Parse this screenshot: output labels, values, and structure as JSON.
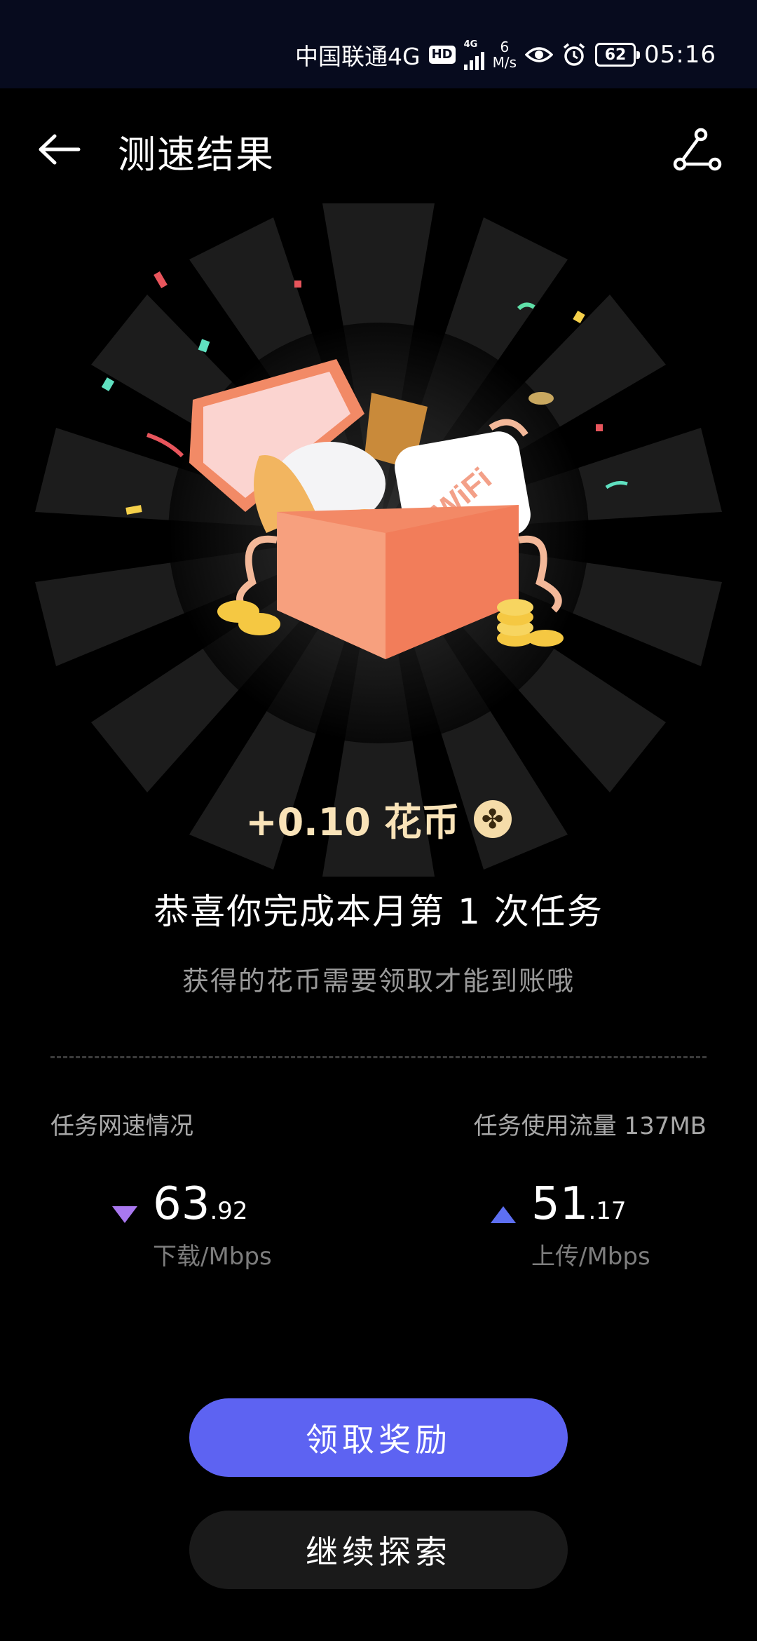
{
  "status_bar": {
    "carrier": "中国联通4G",
    "hd": "HD",
    "signal_label": "4G",
    "net_speed_value": "6",
    "net_speed_unit": "M/s",
    "battery": "62",
    "time": "05:16"
  },
  "header": {
    "title": "测速结果"
  },
  "reward": {
    "amount": "+0.10 花币",
    "coin_symbol": "✤"
  },
  "message": {
    "congrats": "恭喜你完成本月第 1 次任务",
    "hint": "获得的花币需要领取才能到账哦"
  },
  "stats": {
    "speed_label": "任务网速情况",
    "traffic_label": "任务使用流量 137MB",
    "download": {
      "int": "63",
      "dec": ".92",
      "unit": "下载/Mbps"
    },
    "upload": {
      "int": "51",
      "dec": ".17",
      "unit": "上传/Mbps"
    }
  },
  "buttons": {
    "claim": "领取奖励",
    "explore": "继续探索"
  },
  "colors": {
    "accent": "#5d63f2",
    "download_arrow": "#a978f0",
    "upload_arrow": "#5d6ff2",
    "reward_gold": "#f9e3b8"
  }
}
